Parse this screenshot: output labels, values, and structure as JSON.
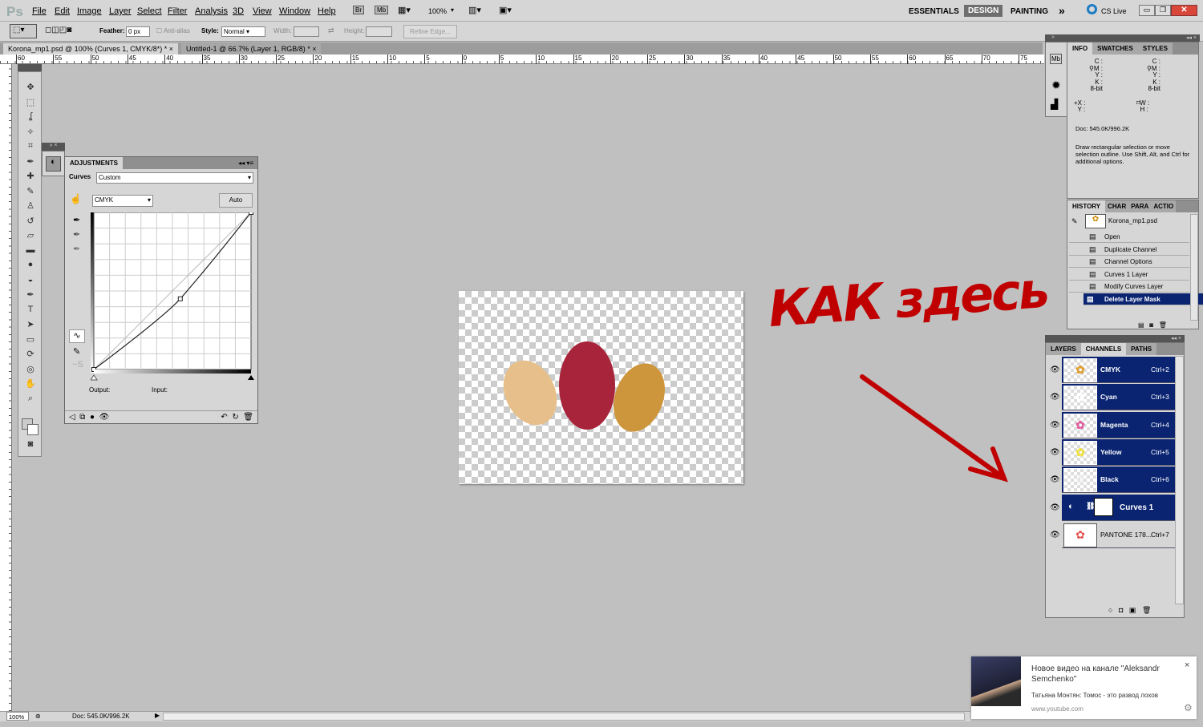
{
  "app": {
    "logo": "Ps"
  },
  "menu": [
    "File",
    "Edit",
    "Image",
    "Layer",
    "Select",
    "Filter",
    "Analysis",
    "3D",
    "View",
    "Window",
    "Help"
  ],
  "app_bar": {
    "bridge": "Br",
    "minibridge": "Mb",
    "zoom": "100%"
  },
  "workspaces": [
    "ESSENTIALS",
    "DESIGN",
    "PAINTING"
  ],
  "workspace_active": "DESIGN",
  "more": "»",
  "cs_live": "CS Live",
  "options": {
    "feather_label": "Feather:",
    "feather_value": "0 px",
    "antialias": "Anti-alias",
    "style_label": "Style:",
    "style_value": "Normal",
    "width_label": "Width:",
    "height_label": "Height:",
    "refine": "Refine Edge..."
  },
  "doc_tabs": [
    {
      "label": "Korona_mp1.psd @ 100% (Curves 1, CMYK/8*) *",
      "close": "×"
    },
    {
      "label": "Untitled-1 @ 66.7% (Layer 1, RGB/8) *",
      "close": "×"
    }
  ],
  "ruler_top": [
    "60",
    "55",
    "50",
    "45",
    "40",
    "35",
    "30",
    "25",
    "20",
    "15",
    "10",
    "5",
    "0",
    "5",
    "10",
    "15",
    "20",
    "25",
    "30",
    "35",
    "40",
    "45",
    "50",
    "55",
    "60",
    "65",
    "70",
    "75"
  ],
  "adjustments": {
    "tab": "ADJUSTMENTS",
    "type_label": "Curves",
    "preset": "Custom",
    "channel": "CMYK",
    "auto": "Auto",
    "output_label": "Output:",
    "input_label": "Input:",
    "curve_points": [
      [
        0,
        0
      ],
      [
        0.55,
        0.45
      ],
      [
        1,
        1
      ]
    ]
  },
  "info": {
    "tabs": [
      "INFO",
      "SWATCHES",
      "STYLES"
    ],
    "cmyk_labels": [
      "C :",
      "M :",
      "Y :",
      "K :"
    ],
    "bit": "8-bit",
    "xy": [
      "X :",
      "Y :"
    ],
    "wh": [
      "W :",
      "H :"
    ],
    "doc": "Doc: 545.0K/996.2K",
    "hint": "Draw rectangular selection or move selection outline.  Use Shift, Alt, and Ctrl for additional options."
  },
  "history": {
    "tabs": [
      "HISTORY",
      "CHAR",
      "PARA",
      "ACTIO"
    ],
    "snapshot": "Korona_mp1.psd",
    "items": [
      "Open",
      "Duplicate Channel",
      "Channel Options",
      "Curves 1 Layer",
      "Modify Curves Layer",
      "Delete Layer Mask"
    ],
    "active": "Delete Layer Mask"
  },
  "channels": {
    "tabs": [
      "LAYERS",
      "CHANNELS",
      "PATHS"
    ],
    "active_tab": "CHANNELS",
    "items": [
      {
        "name": "CMYK",
        "shortcut": "Ctrl+2"
      },
      {
        "name": "Cyan",
        "shortcut": "Ctrl+3"
      },
      {
        "name": "Magenta",
        "shortcut": "Ctrl+4"
      },
      {
        "name": "Yellow",
        "shortcut": "Ctrl+5"
      },
      {
        "name": "Black",
        "shortcut": "Ctrl+6"
      },
      {
        "name": "Curves 1",
        "shortcut": ""
      },
      {
        "name": "PANTONE 178...",
        "shortcut": "Ctrl+7"
      }
    ]
  },
  "annotation_text": "КАК здесь",
  "status": {
    "zoom": "100%",
    "doc": "Doc: 545.0K/996.2K"
  },
  "notification": {
    "title": "Новое видео на канале \"Aleksandr Semchenko\"",
    "body": "Татьяна Монтян: Томос - это развод лохов",
    "source": "www.youtube.com",
    "close": "×"
  },
  "colors": {
    "selection": "#0a2472",
    "annotation": "#c00000",
    "close_red": "#d9463a"
  }
}
